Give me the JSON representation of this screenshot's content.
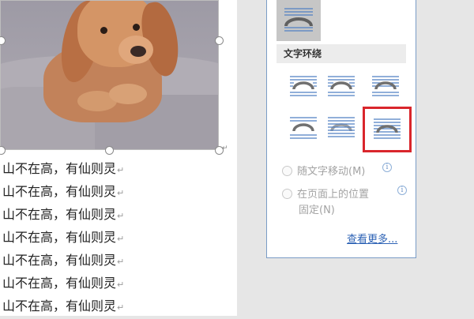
{
  "document": {
    "lines": [
      "山不在高，有仙则灵",
      "山不在高，有仙则灵",
      "山不在高，有仙则灵",
      "山不在高，有仙则灵",
      "山不在高，有仙则灵",
      "山不在高，有仙则灵",
      "山不在高，有仙则灵"
    ],
    "paragraph_mark": "↵",
    "anchor_mark": "↵"
  },
  "panel": {
    "section_title": "文字环绕",
    "options": {
      "move_with_text": "随文字移动(M)",
      "fix_position_line1": "在页面上的位置",
      "fix_position_line2": "固定(N)"
    },
    "info_glyph": "i",
    "see_more": "查看更多..."
  },
  "colors": {
    "selection_outline": "#d9262c",
    "icon_lines": "#4f7fc2",
    "icon_shape": "#707070",
    "link": "#2e63b5"
  }
}
